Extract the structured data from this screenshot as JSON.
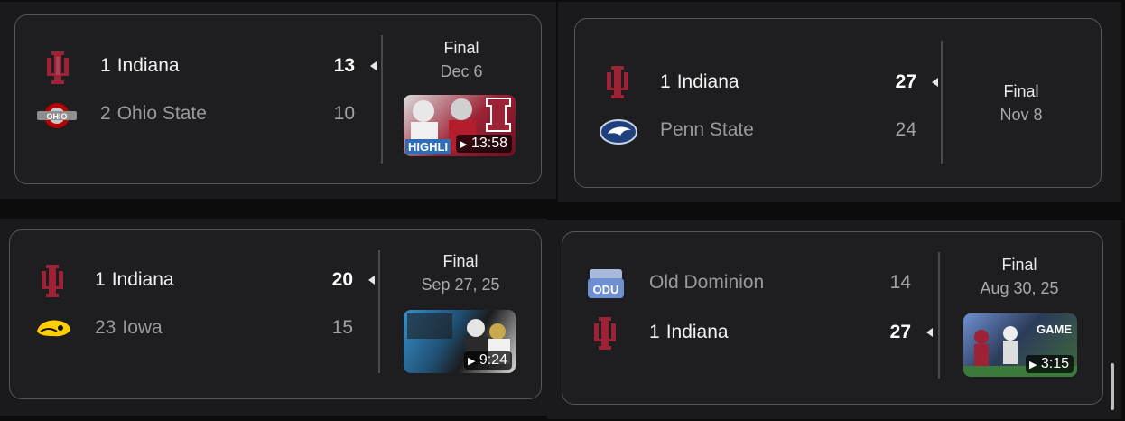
{
  "games": [
    {
      "status": "Final",
      "date": "Dec 6",
      "video_duration": "13:58",
      "video_caption": "HIGHLI",
      "teams": [
        {
          "rank": "1",
          "name": "Indiana",
          "score": "13",
          "logo": "indiana-logo",
          "winner": true
        },
        {
          "rank": "2",
          "name": "Ohio State",
          "score": "10",
          "logo": "ohio-state-logo",
          "winner": false
        }
      ]
    },
    {
      "status": "Final",
      "date": "Nov 8",
      "teams": [
        {
          "rank": "1",
          "name": "Indiana",
          "score": "27",
          "logo": "indiana-logo",
          "winner": true
        },
        {
          "rank": "",
          "name": "Penn State",
          "score": "24",
          "logo": "penn-state-logo",
          "winner": false
        }
      ]
    },
    {
      "status": "Final",
      "date": "Sep 27, 25",
      "video_duration": "9:24",
      "teams": [
        {
          "rank": "1",
          "name": "Indiana",
          "score": "20",
          "logo": "indiana-logo",
          "winner": true
        },
        {
          "rank": "23",
          "name": "Iowa",
          "score": "15",
          "logo": "iowa-logo",
          "winner": false
        }
      ]
    },
    {
      "status": "Final",
      "date": "Aug 30, 25",
      "video_duration": "3:15",
      "video_caption": "GAME",
      "teams": [
        {
          "rank": "",
          "name": "Old Dominion",
          "score": "14",
          "logo": "old-dominion-logo",
          "winner": false
        },
        {
          "rank": "1",
          "name": "Indiana",
          "score": "27",
          "logo": "indiana-logo",
          "winner": true
        }
      ]
    }
  ],
  "colors": {
    "indiana": "#9d2235",
    "ohio_state": "#bb0000",
    "penn_state": "#1e407c",
    "iowa": "#ffcd00",
    "old_dominion": "#6e8fd1"
  },
  "odu_logo_text": "ODU"
}
